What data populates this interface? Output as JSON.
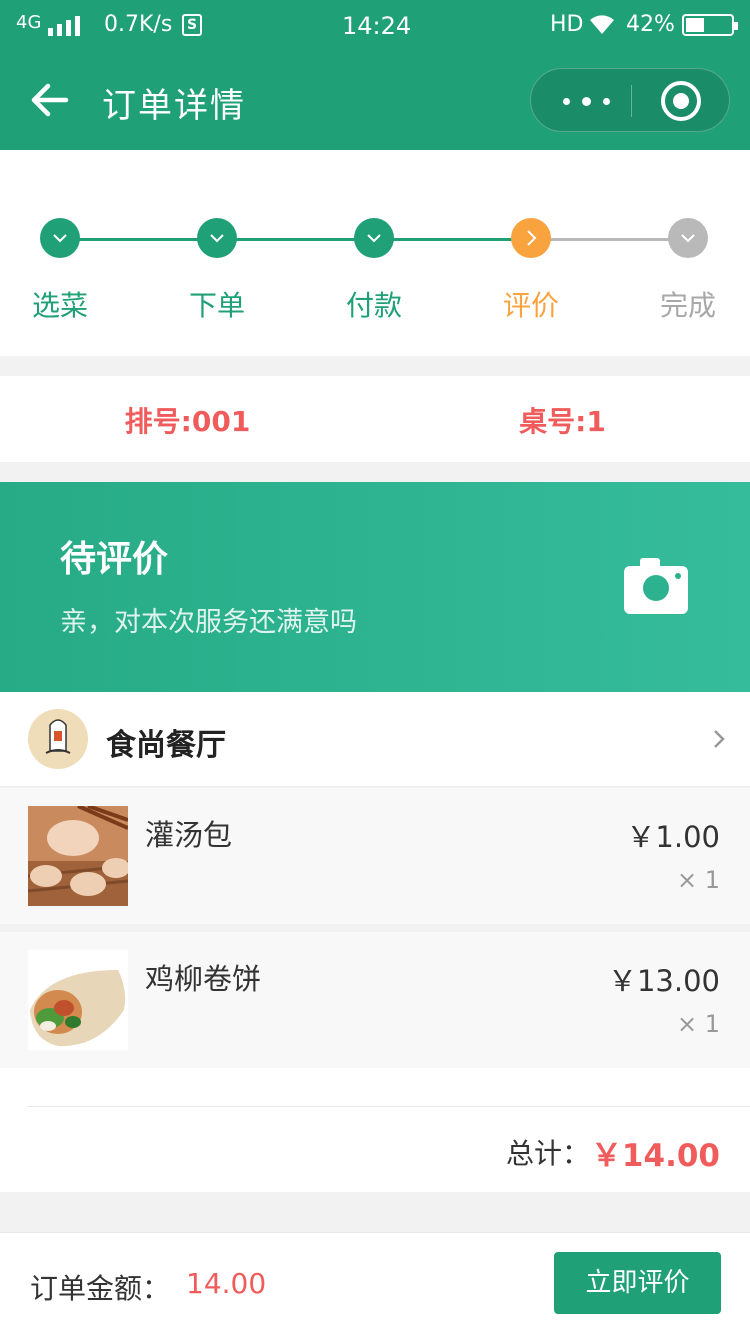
{
  "status_bar": {
    "network": "4G",
    "speed": "0.7K/s",
    "s_badge": "S",
    "time": "14:24",
    "hd": "HD",
    "battery_text": "42%",
    "battery_level": 0.42
  },
  "header": {
    "title": "订单详情",
    "back_icon": "arrow-left-icon",
    "more_icon": "more-dots-icon",
    "close_icon": "target-circle-icon",
    "bg_color": "#1fa077"
  },
  "steps": [
    {
      "label": "选菜",
      "state": "done"
    },
    {
      "label": "下单",
      "state": "done"
    },
    {
      "label": "付款",
      "state": "done"
    },
    {
      "label": "评价",
      "state": "current"
    },
    {
      "label": "完成",
      "state": "pending"
    }
  ],
  "step_colors": {
    "done": "#1fa077",
    "current": "#f8a33d",
    "pending": "#b9b9b9"
  },
  "queue": {
    "queue_no": "排号:001",
    "table_no": "桌号:1"
  },
  "banner": {
    "title": "待评价",
    "subtitle": "亲，对本次服务还满意吗",
    "icon": "camera-icon"
  },
  "restaurant": {
    "name": "食尚餐厅",
    "chevron_icon": "chevron-right-icon"
  },
  "items": [
    {
      "name": "灌汤包",
      "price": "￥1.00",
      "qty": "× 1",
      "image": "soup-dumpling"
    },
    {
      "name": "鸡柳卷饼",
      "price": "￥13.00",
      "qty": "× 1",
      "image": "chicken-wrap"
    }
  ],
  "total": {
    "label": "总计：",
    "value": "￥14.00"
  },
  "footer": {
    "amount_label": "订单金额：",
    "amount_value": "14.00",
    "button_label": "立即评价"
  }
}
